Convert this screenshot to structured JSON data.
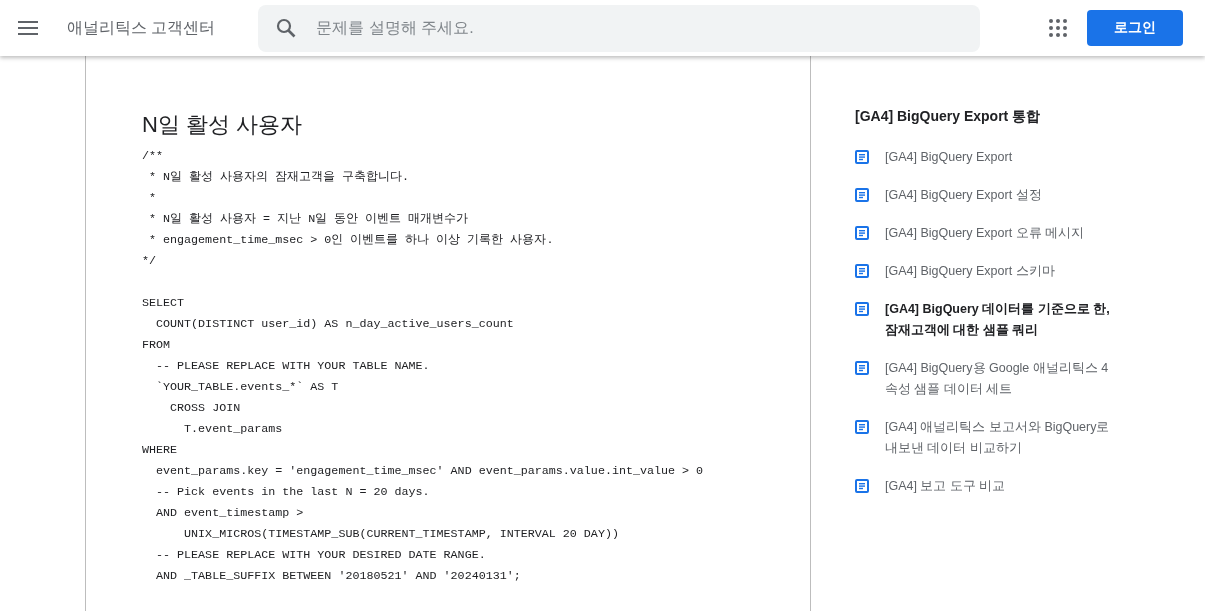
{
  "header": {
    "title": "애널리틱스 고객센터",
    "search": {
      "placeholder": "문제를 설명해 주세요."
    },
    "login_button": "로그인"
  },
  "article": {
    "heading": "N일 활성 사용자",
    "code": [
      [
        "/**",
        " * N일 활성 사용자의 잠재고객을 구축합니다.",
        " *",
        " * N일 활성 사용자 = 지난 N일 동안 이벤트 매개변수가",
        " * engagement_time_msec > 0인 이벤트를 하나 이상 기록한 사용자.",
        "*/"
      ],
      [
        "SELECT",
        "  COUNT(DISTINCT user_id) AS n_day_active_users_count",
        "FROM",
        "  -- PLEASE REPLACE WITH YOUR TABLE NAME.",
        "  `YOUR_TABLE.events_*` AS T",
        "    CROSS JOIN",
        "      T.event_params",
        "WHERE",
        "  event_params.key = 'engagement_time_msec' AND event_params.value.int_value > 0",
        "  -- Pick events in the last N = 20 days.",
        "  AND event_timestamp >",
        "      UNIX_MICROS(TIMESTAMP_SUB(CURRENT_TIMESTAMP, INTERVAL 20 DAY))",
        "  -- PLEASE REPLACE WITH YOUR DESIRED DATE RANGE.",
        "  AND _TABLE_SUFFIX BETWEEN '20180521' AND '20240131';"
      ]
    ]
  },
  "sidebar": {
    "title": "[GA4] BigQuery Export 통합",
    "items": [
      {
        "label": "[GA4] BigQuery Export",
        "selected": false
      },
      {
        "label": "[GA4] BigQuery Export 설정",
        "selected": false
      },
      {
        "label": "[GA4] BigQuery Export 오류 메시지",
        "selected": false
      },
      {
        "label": "[GA4] BigQuery Export 스키마",
        "selected": false
      },
      {
        "label": "[GA4] BigQuery 데이터를 기준으로 한, 잠재고객에 대한 샘플 쿼리",
        "selected": true
      },
      {
        "label": "[GA4] BigQuery용 Google 애널리틱스 4 속성 샘플 데이터 세트",
        "selected": false
      },
      {
        "label": "[GA4] 애널리틱스 보고서와 BigQuery로 내보낸 데이터 비교하기",
        "selected": false
      },
      {
        "label": "[GA4] 보고 도구 비교",
        "selected": false
      }
    ]
  }
}
